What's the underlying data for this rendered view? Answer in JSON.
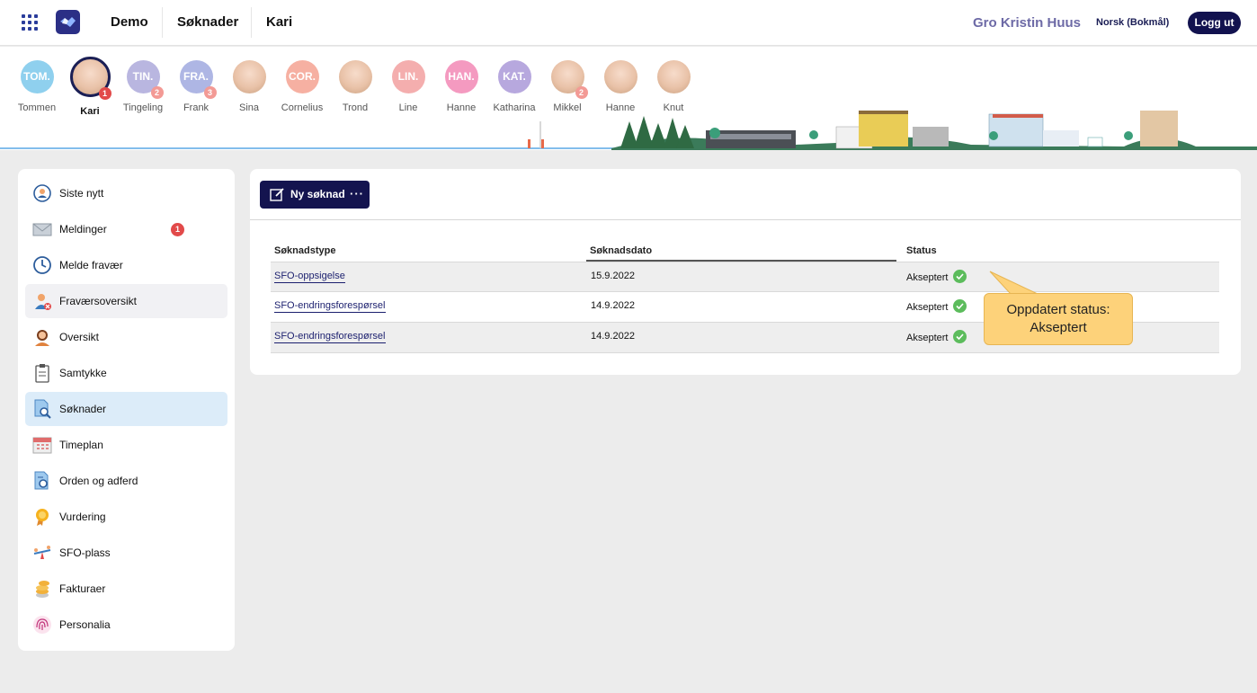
{
  "topbar": {
    "crumbs": [
      "Demo",
      "Søknader",
      "Kari"
    ],
    "user_name": "Gro Kristin Huus",
    "language": "Norsk (Bokmål)",
    "logout_label": "Logg ut"
  },
  "children": [
    {
      "name": "Tommen",
      "initials": "TOM.",
      "color": "#8fd0ee",
      "photo": false,
      "badge": ""
    },
    {
      "name": "Kari",
      "initials": "",
      "color": "#f0c6b0",
      "photo": true,
      "badge": "1",
      "selected": true
    },
    {
      "name": "Tingeling",
      "initials": "TIN.",
      "color": "#b9b6e0",
      "photo": false,
      "badge": "2"
    },
    {
      "name": "Frank",
      "initials": "FRA.",
      "color": "#aeb6e4",
      "photo": false,
      "badge": "3"
    },
    {
      "name": "Sina",
      "initials": "",
      "color": "#d9c2b4",
      "photo": true,
      "badge": ""
    },
    {
      "name": "Cornelius",
      "initials": "COR.",
      "color": "#f6b0a2",
      "photo": false,
      "badge": ""
    },
    {
      "name": "Trond",
      "initials": "",
      "color": "#e8d0c0",
      "photo": true,
      "badge": ""
    },
    {
      "name": "Line",
      "initials": "LIN.",
      "color": "#f4aeae",
      "photo": false,
      "badge": ""
    },
    {
      "name": "Hanne",
      "initials": "HAN.",
      "color": "#f49ac0",
      "photo": false,
      "badge": ""
    },
    {
      "name": "Katharina",
      "initials": "KAT.",
      "color": "#b7a8de",
      "photo": false,
      "badge": ""
    },
    {
      "name": "Mikkel",
      "initials": "",
      "color": "#e4d3c8",
      "photo": true,
      "badge": "2"
    },
    {
      "name": "Hanne",
      "initials": "",
      "color": "#f1d9c9",
      "photo": true,
      "badge": ""
    },
    {
      "name": "Knut",
      "initials": "",
      "color": "#ecd6c2",
      "photo": true,
      "badge": ""
    }
  ],
  "sidebar": {
    "items": [
      {
        "label": "Siste nytt",
        "icon": "news-icon"
      },
      {
        "label": "Meldinger",
        "icon": "envelope-icon",
        "badge": "1"
      },
      {
        "label": "Melde fravær",
        "icon": "clock-icon"
      },
      {
        "label": "Fraværsoversikt",
        "icon": "absence-person-icon"
      },
      {
        "label": "Oversikt",
        "icon": "person-icon"
      },
      {
        "label": "Samtykke",
        "icon": "clipboard-icon"
      },
      {
        "label": "Søknader",
        "icon": "document-search-icon"
      },
      {
        "label": "Timeplan",
        "icon": "calendar-icon"
      },
      {
        "label": "Orden og adferd",
        "icon": "report-icon"
      },
      {
        "label": "Vurdering",
        "icon": "medal-icon"
      },
      {
        "label": "SFO-plass",
        "icon": "seesaw-icon"
      },
      {
        "label": "Fakturaer",
        "icon": "coins-icon"
      },
      {
        "label": "Personalia",
        "icon": "fingerprint-icon"
      }
    ]
  },
  "main": {
    "new_button_label": "Ny søknad",
    "new_button_more": "···",
    "columns": [
      "Søknadstype",
      "Søknadsdato",
      "Status"
    ],
    "rows": [
      {
        "type": "SFO-oppsigelse",
        "date": "15.9.2022",
        "status": "Akseptert"
      },
      {
        "type": "SFO-endringsforespørsel",
        "date": "14.9.2022",
        "status": "Akseptert"
      },
      {
        "type": "SFO-endringsforespørsel",
        "date": "14.9.2022",
        "status": "Akseptert"
      }
    ]
  },
  "callout": {
    "line1": "Oppdatert status:",
    "line2": "Akseptert"
  }
}
